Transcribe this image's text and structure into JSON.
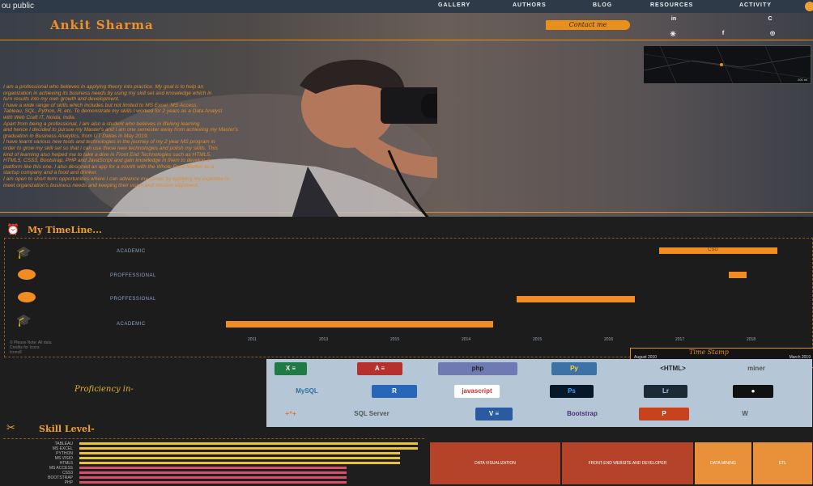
{
  "nav": {
    "brand": "ou public",
    "items": [
      "GALLERY",
      "AUTHORS",
      "BLOG",
      "RESOURCES",
      "ACTIVITY"
    ]
  },
  "hero": {
    "name": "Ankit Sharma",
    "contact_label": "Contact me",
    "social": [
      {
        "name": "linkedin",
        "label": "in",
        "color": "#0a66c2"
      },
      {
        "name": "social-2",
        "label": "",
        "color": "#2b6cb0"
      },
      {
        "name": "social-3",
        "label": "C",
        "color": "#3a7bd5"
      },
      {
        "name": "slack",
        "label": "✳",
        "color": "#611f69"
      },
      {
        "name": "facebook",
        "label": "f",
        "color": "#3b5998"
      },
      {
        "name": "instagram",
        "label": "◎",
        "color": "#d6249f"
      }
    ],
    "bio": [
      "I am a professional who believes in applying theory into practice. My goal is to help an",
      "organization in achieving its business needs by using my skill set and knowledge which in",
      "turn results into my own growth and development.",
      "I have a wide range of skills which includes but not limited to MS Excel, MS Access,",
      "Tableau, SQL, Python, R, etc. To demonstrate my skills I worked for 2 years as a Data Analyst",
      "with Web Craft IT, Noida, India.",
      "Apart from being a professional, I am also a student who believes in lifelong learning",
      "and hence I decided to pursue my Master's and I am one semester away from achieving my Master's",
      "graduation in Business Analytics, from UT Dallas in May 2019.",
      "I have learnt various new tools and technologies in the journey of my 2 year MS program in",
      "order to grow my skill set so that I can use these new technologies and polish my skills. This",
      "kind of learning also helped me to take a dive in Front End Technologies such as HTML5,",
      "HTML5, CSS3, Bootstrap, PHP and JavaScript and gain knowledge in them to develop a",
      "platform like this one. I also designed an app for a month with the Whole Food Market as a",
      "startup company and a food and drinker.",
      "I am open to short term opportunities where I can advance my career by applying my expertise to",
      "meet organization's business needs and keeping their vision and mission alignment."
    ],
    "map_scale": "200 mi"
  },
  "timeline": {
    "title": "My TimeLine...",
    "rows": [
      {
        "label": "ACADEMIC",
        "icon": "graduation-cap-icon",
        "bar_label": "CSU"
      },
      {
        "label": "PROFFESSIONAL",
        "icon": "briefcase-icon",
        "bar_label": ""
      },
      {
        "label": "PROFFESSIONAL",
        "icon": "briefcase-icon",
        "bar_label": ""
      },
      {
        "label": "ACADEMIC",
        "icon": "graduation-cap-icon",
        "bar_label": ""
      }
    ],
    "axis": [
      "2011",
      "2013",
      "2015",
      "2014",
      "2015",
      "2016",
      "2017",
      "2018"
    ],
    "footnote": [
      "© Please Note: All data",
      "Credits for Icons:",
      "Icons8"
    ],
    "timestamp_title": "Time Stamp",
    "timestamp_start": "August 2010",
    "timestamp_end": "March 2019"
  },
  "proficiency": {
    "label": "Proficiency in-",
    "logos": [
      {
        "name": "excel-logo",
        "text": "X ≡",
        "bg": "#1f7a45",
        "fg": "#fff"
      },
      {
        "name": "access-logo",
        "text": "A ≡",
        "bg": "#b7302b",
        "fg": "#fff"
      },
      {
        "name": "php-logo",
        "text": "php",
        "bg": "#6f7ab3",
        "fg": "#222"
      },
      {
        "name": "python-logo",
        "text": "Py",
        "bg": "#3d72a6",
        "fg": "#ffd43b"
      },
      {
        "name": "html-logo",
        "text": "<HTML>",
        "bg": "transparent",
        "fg": "#222"
      },
      {
        "name": "miner-logo",
        "text": "miner",
        "bg": "transparent",
        "fg": "#555"
      },
      {
        "name": "mysql-logo",
        "text": "MySQL",
        "bg": "transparent",
        "fg": "#2f6f9a"
      },
      {
        "name": "r-logo",
        "text": "R",
        "bg": "#2a66b8",
        "fg": "#fff"
      },
      {
        "name": "javascript-logo",
        "text": "javascript",
        "bg": "#fff",
        "fg": "#c33"
      },
      {
        "name": "photoshop-logo",
        "text": "Ps",
        "bg": "#06182a",
        "fg": "#31a8ff"
      },
      {
        "name": "lightroom-logo",
        "text": "Lr",
        "bg": "#1c2a36",
        "fg": "#adc9e6"
      },
      {
        "name": "github-logo",
        "text": "●",
        "bg": "#111",
        "fg": "#fff"
      },
      {
        "name": "tableau-logo",
        "text": "+⁺+",
        "bg": "transparent",
        "fg": "#e8701c"
      },
      {
        "name": "sqlserver-logo",
        "text": "SQL Server",
        "bg": "transparent",
        "fg": "#555"
      },
      {
        "name": "visio-logo",
        "text": "V ≡",
        "bg": "#2a5aa0",
        "fg": "#fff"
      },
      {
        "name": "bootstrap-logo",
        "text": "Bootstrap",
        "bg": "transparent",
        "fg": "#4b2d7a"
      },
      {
        "name": "powerpoint-logo",
        "text": "P",
        "bg": "#c8421e",
        "fg": "#fff"
      },
      {
        "name": "wordpress-logo",
        "text": "W",
        "bg": "transparent",
        "fg": "#555"
      }
    ]
  },
  "skills": {
    "title": "Skill Level-",
    "items": [
      {
        "name": "TABLEAU",
        "value": 0.95,
        "color": "#e8c23a"
      },
      {
        "name": "MS EXCEL",
        "value": 0.95,
        "color": "#e8c23a"
      },
      {
        "name": "PYTHON",
        "value": 0.9,
        "color": "#e8c23a"
      },
      {
        "name": "MS VISIO",
        "value": 0.9,
        "color": "#e8c23a"
      },
      {
        "name": "HTML5",
        "value": 0.9,
        "color": "#e8c23a"
      },
      {
        "name": "MS ACCESS",
        "value": 0.75,
        "color": "#d8506a"
      },
      {
        "name": "CSS3",
        "value": 0.75,
        "color": "#d8506a"
      },
      {
        "name": "BOOTSTRAP",
        "value": 0.75,
        "color": "#d8506a"
      },
      {
        "name": "PHP",
        "value": 0.75,
        "color": "#d8506a"
      }
    ],
    "treemap": [
      {
        "label": "DATA VISUALIZATION",
        "color": "#b5432a"
      },
      {
        "label": "FRONT-END WEBSITE AND DEVELOPER",
        "color": "#b5432a"
      },
      {
        "label": "DATA MINING",
        "color": "#e8903a"
      },
      {
        "label": "ETL",
        "color": "#e8903a"
      }
    ]
  }
}
